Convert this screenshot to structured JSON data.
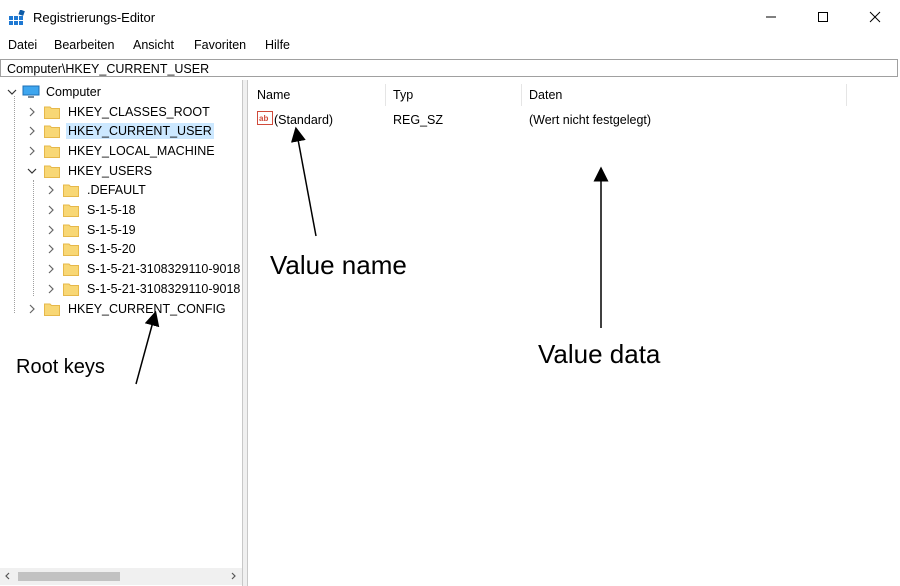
{
  "window": {
    "title": "Registrierungs-Editor"
  },
  "menu": [
    "Datei",
    "Bearbeiten",
    "Ansicht",
    "Favoriten",
    "Hilfe"
  ],
  "address": "Computer\\HKEY_CURRENT_USER",
  "tree": {
    "root": "Computer",
    "keys": [
      {
        "label": "HKEY_CLASSES_ROOT",
        "level": 1,
        "expanded": false,
        "selected": false
      },
      {
        "label": "HKEY_CURRENT_USER",
        "level": 1,
        "expanded": false,
        "selected": true
      },
      {
        "label": "HKEY_LOCAL_MACHINE",
        "level": 1,
        "expanded": false,
        "selected": false
      },
      {
        "label": "HKEY_USERS",
        "level": 1,
        "expanded": true,
        "selected": false
      },
      {
        "label": ".DEFAULT",
        "level": 2,
        "expanded": false,
        "selected": false
      },
      {
        "label": "S-1-5-18",
        "level": 2,
        "expanded": false,
        "selected": false
      },
      {
        "label": "S-1-5-19",
        "level": 2,
        "expanded": false,
        "selected": false
      },
      {
        "label": "S-1-5-20",
        "level": 2,
        "expanded": false,
        "selected": false
      },
      {
        "label": "S-1-5-21-3108329110-9018",
        "level": 2,
        "expanded": false,
        "selected": false
      },
      {
        "label": "S-1-5-21-3108329110-9018",
        "level": 2,
        "expanded": false,
        "selected": false
      },
      {
        "label": "HKEY_CURRENT_CONFIG",
        "level": 1,
        "expanded": false,
        "selected": false
      }
    ]
  },
  "list": {
    "columns": [
      "Name",
      "Typ",
      "Daten"
    ],
    "rows": [
      {
        "name": "(Standard)",
        "type": "REG_SZ",
        "data": "(Wert nicht festgelegt)",
        "icon": "string-value-icon"
      }
    ]
  },
  "annotations": {
    "root_keys": "Root keys",
    "value_name": "Value name",
    "value_data": "Value data"
  },
  "colors": {
    "selection": "#cce8ff",
    "folder": "#f8d775",
    "folder_dark": "#e6b84a"
  }
}
